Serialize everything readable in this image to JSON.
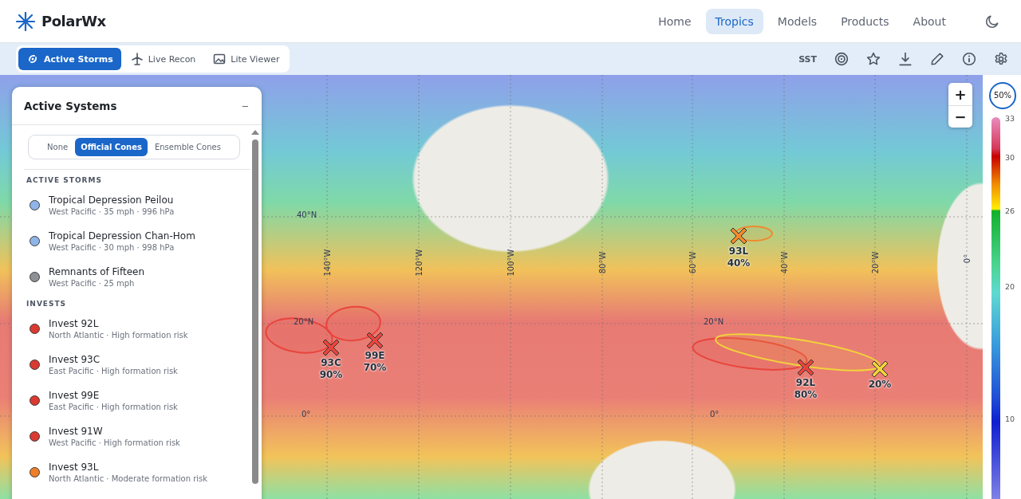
{
  "header": {
    "brand": "PolarWx",
    "nav": [
      {
        "label": "Home",
        "selected": false
      },
      {
        "label": "Tropics",
        "selected": true
      },
      {
        "label": "Models",
        "selected": false
      },
      {
        "label": "Products",
        "selected": false
      },
      {
        "label": "About",
        "selected": false
      }
    ]
  },
  "toolbar": {
    "tabs": [
      {
        "label": "Active Storms",
        "selected": true
      },
      {
        "label": "Live Recon",
        "selected": false
      },
      {
        "label": "Lite Viewer",
        "selected": false
      }
    ],
    "layer": "SST"
  },
  "panel": {
    "title": "Active Systems",
    "collapse": "–",
    "cone_modes": [
      {
        "label": "None",
        "selected": false
      },
      {
        "label": "Official Cones",
        "selected": true
      },
      {
        "label": "Ensemble Cones",
        "selected": false
      }
    ],
    "sections": [
      {
        "heading": "ACTIVE STORMS",
        "items": [
          {
            "name": "Tropical Depression Peilou",
            "detail": "West Pacific · 35 mph · 996 hPa",
            "color": "#8fb4e8"
          },
          {
            "name": "Tropical Depression Chan-Hom",
            "detail": "West Pacific · 30 mph · 998 hPa",
            "color": "#8fb4e8"
          },
          {
            "name": "Remnants of Fifteen",
            "detail": "West Pacific · 25 mph",
            "color": "#8e9096"
          }
        ]
      },
      {
        "heading": "INVESTS",
        "items": [
          {
            "name": "Invest 92L",
            "detail": "North Atlantic · High formation risk",
            "color": "#d93a32"
          },
          {
            "name": "Invest 93C",
            "detail": "East Pacific · High formation risk",
            "color": "#d93a32"
          },
          {
            "name": "Invest 99E",
            "detail": "East Pacific · High formation risk",
            "color": "#d93a32"
          },
          {
            "name": "Invest 91W",
            "detail": "West Pacific · High formation risk",
            "color": "#d93a32"
          },
          {
            "name": "Invest 93L",
            "detail": "North Atlantic · Moderate formation risk",
            "color": "#ee7e2a"
          }
        ]
      }
    ]
  },
  "map": {
    "lat_labels": [
      "40°N",
      "20°N",
      "20°N",
      "0°",
      "0°"
    ],
    "lon_labels": [
      "140°W",
      "120°W",
      "100°W",
      "80°W",
      "60°W",
      "40°W",
      "20°W",
      "0°"
    ],
    "markers": [
      {
        "name": "93C",
        "chance": "90%",
        "color": "#e8453c"
      },
      {
        "name": "99E",
        "chance": "70%",
        "color": "#e8453c"
      },
      {
        "name": "93L",
        "chance": "40%",
        "color": "#f08a2c"
      },
      {
        "name": "92L",
        "chance": "80%",
        "color": "#e8453c"
      },
      {
        "chance": "20%",
        "color": "#f2d33a"
      }
    ],
    "zoom_in": "+",
    "zoom_out": "−"
  },
  "legend": {
    "opacity": "50%",
    "ticks": [
      "33",
      "30",
      "26",
      "20",
      "10"
    ]
  }
}
